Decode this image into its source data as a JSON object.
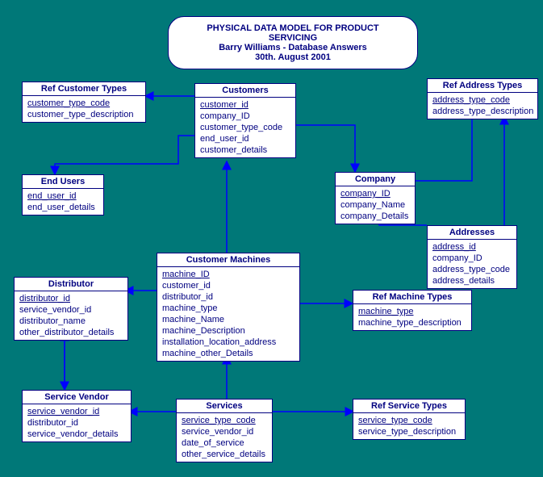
{
  "title": {
    "line1": "PHYSICAL DATA MODEL FOR PRODUCT SERVICING",
    "line2": "Barry Williams - Database Answers",
    "line3": "30th. August 2001"
  },
  "entities": {
    "ref_customer_types": {
      "name": "Ref Customer Types",
      "attrs": [
        "customer_type_code",
        "customer_type_description"
      ],
      "pk": [
        0
      ]
    },
    "customers": {
      "name": "Customers",
      "attrs": [
        "customer_id",
        "company_ID",
        "customer_type_code",
        "end_user_id",
        "customer_details"
      ],
      "pk": [
        0
      ]
    },
    "ref_address_types": {
      "name": "Ref Address Types",
      "attrs": [
        "address_type_code",
        "address_type_description"
      ],
      "pk": [
        0
      ]
    },
    "end_users": {
      "name": "End Users",
      "attrs": [
        "end_user_id",
        "end_user_details"
      ],
      "pk": [
        0
      ]
    },
    "company": {
      "name": "Company",
      "attrs": [
        "company_ID",
        "company_Name",
        "company_Details"
      ],
      "pk": [
        0
      ]
    },
    "addresses": {
      "name": "Addresses",
      "attrs": [
        "address_id",
        "company_ID",
        "address_type_code",
        "address_details"
      ],
      "pk": [
        0
      ]
    },
    "customer_machines": {
      "name": "Customer Machines",
      "attrs": [
        "machine_ID",
        "customer_id",
        "distributor_id",
        "machine_type",
        "machine_Name",
        "machine_Description",
        "installation_location_address",
        "machine_other_Details"
      ],
      "pk": [
        0
      ]
    },
    "distributor": {
      "name": "Distributor",
      "attrs": [
        "distributor_id",
        "service_vendor_id",
        "distributor_name",
        "other_distributor_details"
      ],
      "pk": [
        0
      ]
    },
    "ref_machine_types": {
      "name": "Ref Machine Types",
      "attrs": [
        "machine_type",
        "machine_type_description"
      ],
      "pk": [
        0
      ]
    },
    "service_vendor": {
      "name": "Service Vendor",
      "attrs": [
        "service_vendor_id",
        "distributor_id",
        "service_vendor_details"
      ],
      "pk": [
        0
      ]
    },
    "services": {
      "name": "Services",
      "attrs": [
        "service_type_code",
        "service_vendor_id",
        "date_of_service",
        "other_service_details"
      ],
      "pk": [
        0
      ]
    },
    "ref_service_types": {
      "name": "Ref Service Types",
      "attrs": [
        "service_type_code",
        "service_type_description"
      ],
      "pk": [
        0
      ]
    }
  }
}
